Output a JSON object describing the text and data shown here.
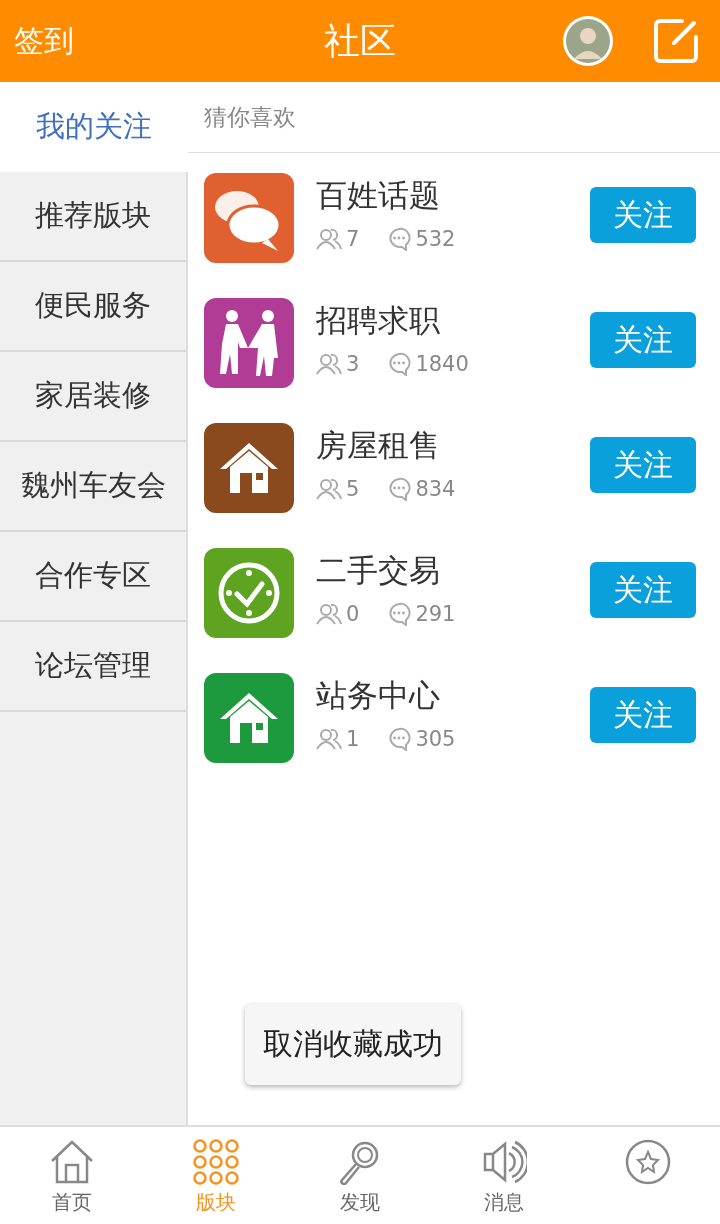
{
  "header": {
    "left": "签到",
    "title": "社区"
  },
  "sidebar": {
    "items": [
      {
        "label": "我的关注",
        "selected": true
      },
      {
        "label": "推荐版块",
        "selected": false
      },
      {
        "label": "便民服务",
        "selected": false
      },
      {
        "label": "家居装修",
        "selected": false
      },
      {
        "label": "魏州车友会",
        "selected": false
      },
      {
        "label": "合作专区",
        "selected": false
      },
      {
        "label": "论坛管理",
        "selected": false
      }
    ]
  },
  "section_title": "猜你喜欢",
  "forums": [
    {
      "name": "百姓话题",
      "kind": "chat",
      "color": "#e0602f",
      "members": "7",
      "posts": "532",
      "button": "关注"
    },
    {
      "name": "招聘求职",
      "kind": "handshake",
      "color": "#b03c96",
      "members": "3",
      "posts": "1840",
      "button": "关注"
    },
    {
      "name": "房屋租售",
      "kind": "house",
      "color": "#8a4a1e",
      "members": "5",
      "posts": "834",
      "button": "关注"
    },
    {
      "name": "二手交易",
      "kind": "clock",
      "color": "#5fa421",
      "members": "0",
      "posts": "291",
      "button": "关注"
    },
    {
      "name": "站务中心",
      "kind": "house",
      "color": "#1e9a3e",
      "members": "1",
      "posts": "305",
      "button": "关注"
    }
  ],
  "toast": "取消收藏成功",
  "tabs": [
    {
      "kind": "home",
      "label": "首页",
      "selected": false
    },
    {
      "kind": "grid",
      "label": "版块",
      "selected": true
    },
    {
      "kind": "search",
      "label": "发现",
      "selected": false
    },
    {
      "kind": "speaker",
      "label": "消息",
      "selected": false
    },
    {
      "kind": "star",
      "selected": false
    }
  ]
}
